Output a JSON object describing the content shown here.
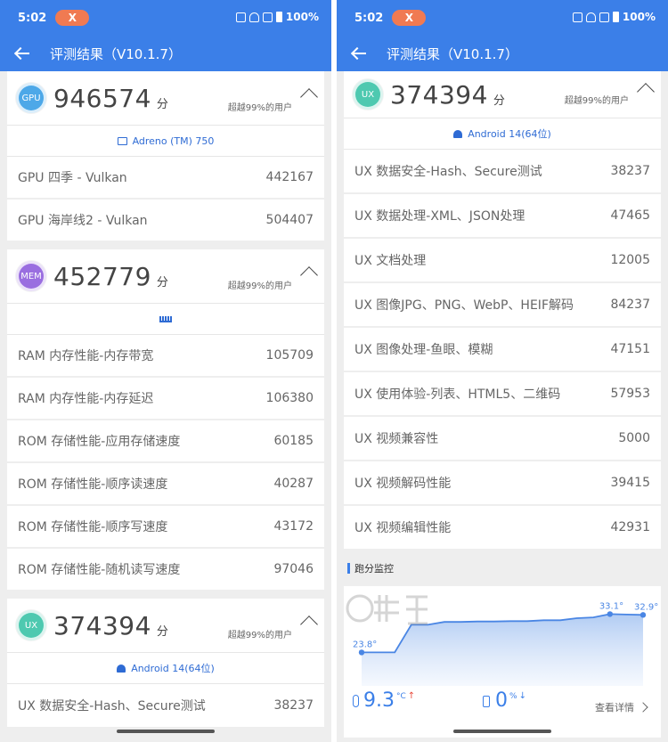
{
  "status": {
    "time": "5:02",
    "pill": "X",
    "battery": "100%"
  },
  "appbar": {
    "title": "评测结果（V10.1.7）"
  },
  "gpu": {
    "badge": "GPU",
    "score": "946574",
    "unit": "分",
    "exceed": "超越99%的用户",
    "device": "Adreno (TM) 750",
    "items": [
      {
        "label": "GPU 四季 - Vulkan",
        "value": "442167"
      },
      {
        "label": "GPU 海岸线2 - Vulkan",
        "value": "504407"
      }
    ]
  },
  "mem": {
    "badge": "MEM",
    "score": "452779",
    "unit": "分",
    "exceed": "超越99%的用户",
    "items": [
      {
        "label": "RAM 内存性能-内存带宽",
        "value": "105709"
      },
      {
        "label": "RAM 内存性能-内存延迟",
        "value": "106380"
      },
      {
        "label": "ROM 存储性能-应用存储速度",
        "value": "60185"
      },
      {
        "label": "ROM 存储性能-顺序读速度",
        "value": "40287"
      },
      {
        "label": "ROM 存储性能-顺序写速度",
        "value": "43172"
      },
      {
        "label": "ROM 存储性能-随机读写速度",
        "value": "97046"
      }
    ]
  },
  "ux": {
    "badge": "UX",
    "score": "374394",
    "unit": "分",
    "exceed": "超越99%的用户",
    "device": "Android 14(64位)",
    "items": [
      {
        "label": "UX 数据安全-Hash、Secure测试",
        "value": "38237"
      },
      {
        "label": "UX 数据处理-XML、JSON处理",
        "value": "47465"
      },
      {
        "label": "UX 文档处理",
        "value": "12005"
      },
      {
        "label": "UX 图像JPG、PNG、WebP、HEIF解码",
        "value": "84237"
      },
      {
        "label": "UX 图像处理-鱼眼、模糊",
        "value": "47151"
      },
      {
        "label": "UX 使用体验-列表、HTML5、二维码",
        "value": "57953"
      },
      {
        "label": "UX 视频兼容性",
        "value": "5000"
      },
      {
        "label": "UX 视频解码性能",
        "value": "39415"
      },
      {
        "label": "UX 视频编辑性能",
        "value": "42931"
      }
    ]
  },
  "monitor": {
    "title": "跑分监控",
    "start_label": "23.8°",
    "peak_label": "33.1°",
    "end_label": "32.9°",
    "temp_rise": "9.3",
    "temp_unit": "°C",
    "battery_drop": "0",
    "battery_unit": "%",
    "detail": "查看详情"
  },
  "chart_data": {
    "type": "area",
    "title": "跑分监控",
    "series": [
      {
        "values": [
          23.8,
          23.8,
          23.8,
          30.5,
          30.5,
          31.2,
          31.2,
          31.3,
          31.3,
          31.4,
          31.4,
          31.6,
          31.6,
          32.1,
          32.3,
          33.1,
          33.0,
          32.9
        ]
      }
    ],
    "annotations": [
      "23.8°",
      "33.1°",
      "32.9°"
    ],
    "ylim": [
      20,
      36
    ],
    "grid": false
  },
  "colors": {
    "primary": "#3b7fe8",
    "gpu": "#4da8e8",
    "mem": "#9a6ee0",
    "ux": "#4ec9b0",
    "accent_pill": "#f07a52"
  }
}
